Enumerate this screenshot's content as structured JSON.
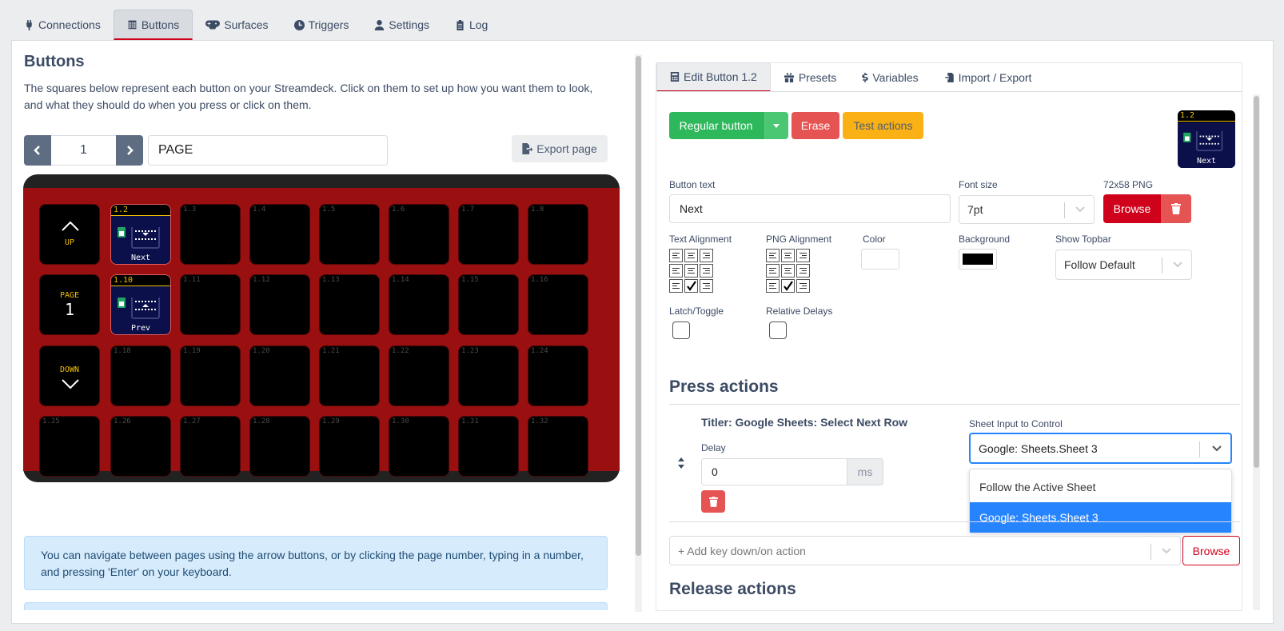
{
  "nav": {
    "tabs": [
      {
        "label": "Connections",
        "icon": "plug-icon"
      },
      {
        "label": "Buttons",
        "icon": "calendar-grid-icon"
      },
      {
        "label": "Surfaces",
        "icon": "gamepad-icon"
      },
      {
        "label": "Triggers",
        "icon": "clock-icon"
      },
      {
        "label": "Settings",
        "icon": "user-cog-icon"
      },
      {
        "label": "Log",
        "icon": "clipboard-icon"
      }
    ],
    "active": "Buttons"
  },
  "buttons_panel": {
    "title": "Buttons",
    "description": "The squares below represent each button on your Streamdeck. Click on them to set up how you want them to look, and what they should do when you press or click on them.",
    "page_number": "1",
    "page_name": "PAGE",
    "export_label": "Export page",
    "info_text": "You can navigate between pages using the arrow buttons, or by clicking the page number, typing in a number, and pressing 'Enter' on your keyboard."
  },
  "grid": {
    "up_label": "UP",
    "page_label": "PAGE",
    "page_value": "1",
    "down_label": "DOWN",
    "row1": [
      "1.2",
      "1.3",
      "1.4",
      "1.5",
      "1.6",
      "1.7",
      "1.8"
    ],
    "row2": [
      "1.10",
      "1.11",
      "1.12",
      "1.13",
      "1.14",
      "1.15",
      "1.16"
    ],
    "row3": [
      "1.18",
      "1.19",
      "1.20",
      "1.21",
      "1.22",
      "1.23",
      "1.24"
    ],
    "row4": [
      "1.25",
      "1.26",
      "1.27",
      "1.28",
      "1.29",
      "1.30",
      "1.31",
      "1.32"
    ],
    "key_1_2_text": "Next",
    "key_1_10_text": "Prev"
  },
  "editor": {
    "tabs": [
      {
        "label": "Edit Button 1.2",
        "icon": "calculator-icon"
      },
      {
        "label": "Presets",
        "icon": "gift-icon"
      },
      {
        "label": "Variables",
        "icon": "dollar-icon"
      },
      {
        "label": "Import / Export",
        "icon": "file-import-icon"
      }
    ],
    "regular_button": "Regular button",
    "erase": "Erase",
    "test_actions": "Test actions",
    "preview_number": "1.2",
    "preview_text": "Next",
    "button_text_label": "Button text",
    "button_text_value": "Next",
    "font_size_label": "Font size",
    "font_size_value": "7pt",
    "png_label": "72x58 PNG",
    "browse": "Browse",
    "text_alignment_label": "Text Alignment",
    "png_alignment_label": "PNG Alignment",
    "color_label": "Color",
    "background_label": "Background",
    "show_topbar_label": "Show Topbar",
    "show_topbar_value": "Follow Default",
    "latch_label": "Latch/Toggle",
    "relative_delays_label": "Relative Delays",
    "text_color": "#ffffff",
    "background_color": "#000000",
    "press_actions_title": "Press actions",
    "action_name": "Titler: Google Sheets: Select Next Row",
    "delay_label": "Delay",
    "delay_value": "0",
    "delay_unit": "ms",
    "sheet_input_label": "Sheet Input to Control",
    "sheet_input_value": "Google: Sheets.Sheet 3",
    "sheet_options": [
      "Follow the Active Sheet",
      "Google: Sheets.Sheet 3"
    ],
    "add_action_placeholder": "+ Add key down/on action",
    "add_action_browse": "Browse",
    "release_actions_title": "Release actions"
  },
  "colors": {
    "accent_red": "#d0021b",
    "deck_red": "#9a0f0f",
    "green": "#2eb85c",
    "erase_red": "#e55353",
    "yellow": "#f9b115",
    "select_blue": "#2684ff"
  }
}
